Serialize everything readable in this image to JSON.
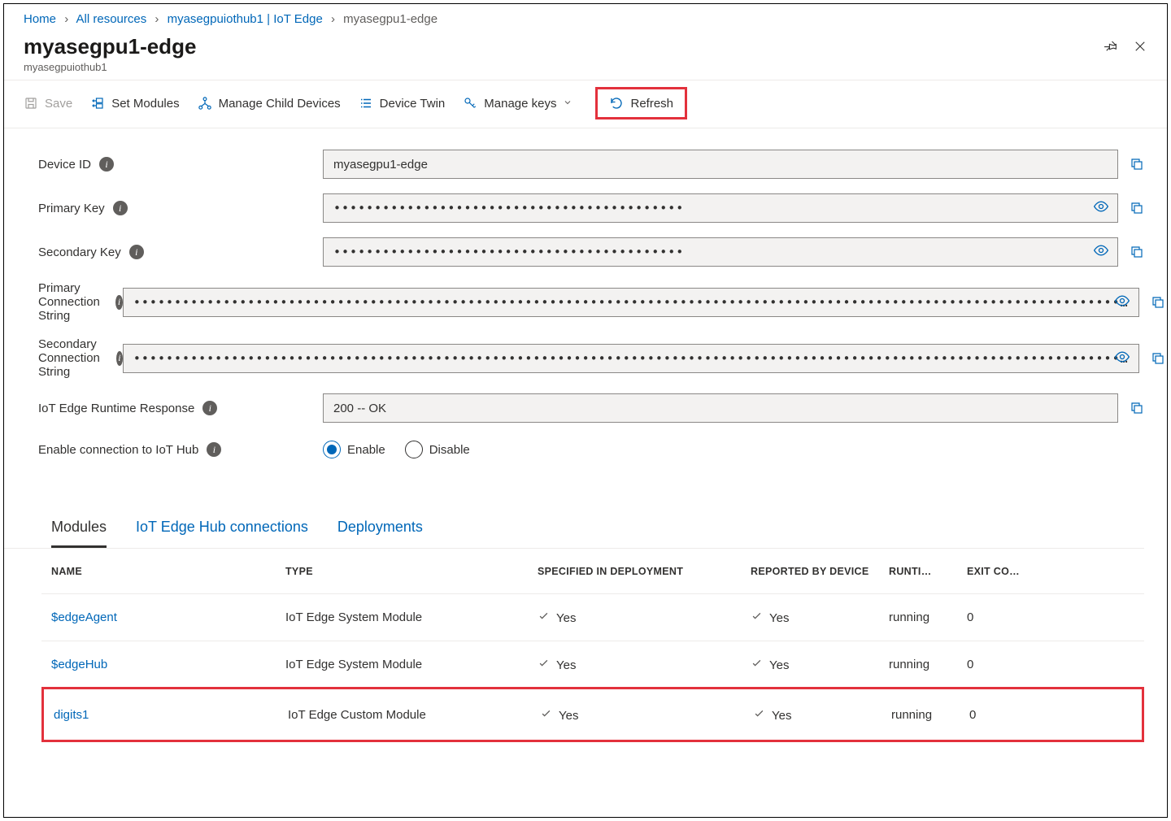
{
  "breadcrumb": {
    "items": [
      "Home",
      "All resources",
      "myasegpuiothub1 | IoT Edge"
    ],
    "current": "myasegpu1-edge"
  },
  "header": {
    "title": "myasegpu1-edge",
    "subtitle": "myasegpuiothub1"
  },
  "toolbar": {
    "save": "Save",
    "set_modules": "Set Modules",
    "manage_child": "Manage Child Devices",
    "device_twin": "Device Twin",
    "manage_keys": "Manage keys",
    "refresh": "Refresh"
  },
  "fields": {
    "device_id": {
      "label": "Device ID",
      "value": "myasegpu1-edge"
    },
    "primary_key": {
      "label": "Primary Key",
      "value": "•••••••••••••••••••••••••••••••••••••••••••"
    },
    "secondary_key": {
      "label": "Secondary Key",
      "value": "•••••••••••••••••••••••••••••••••••••••••••"
    },
    "primary_conn": {
      "label": "Primary Connection String",
      "value": "•••••••••••••••••••••••••••••••••••••••••••••••••••••••••••••••••••••••••••••••••••••••••••••••••••••••••••••••••••••••••…"
    },
    "secondary_conn": {
      "label": "Secondary Connection String",
      "value": "•••••••••••••••••••••••••••••••••••••••••••••••••••••••••••••••••••••••••••••••••••••••••••••••••••••••••••••••••••••••••…"
    },
    "runtime_resp": {
      "label": "IoT Edge Runtime Response",
      "value": "200 -- OK"
    },
    "enable_conn": {
      "label": "Enable connection to IoT Hub",
      "enable": "Enable",
      "disable": "Disable"
    }
  },
  "tabs": {
    "modules": "Modules",
    "connections": "IoT Edge Hub connections",
    "deployments": "Deployments"
  },
  "table": {
    "headers": {
      "name": "NAME",
      "type": "TYPE",
      "spec": "SPECIFIED IN DEPLOYMENT",
      "rep": "REPORTED BY DEVICE",
      "run": "RUNTI…",
      "exit": "EXIT CO…"
    },
    "rows": [
      {
        "name": "$edgeAgent",
        "type": "IoT Edge System Module",
        "spec": "Yes",
        "rep": "Yes",
        "run": "running",
        "exit": "0"
      },
      {
        "name": "$edgeHub",
        "type": "IoT Edge System Module",
        "spec": "Yes",
        "rep": "Yes",
        "run": "running",
        "exit": "0"
      },
      {
        "name": "digits1",
        "type": "IoT Edge Custom Module",
        "spec": "Yes",
        "rep": "Yes",
        "run": "running",
        "exit": "0"
      }
    ]
  }
}
